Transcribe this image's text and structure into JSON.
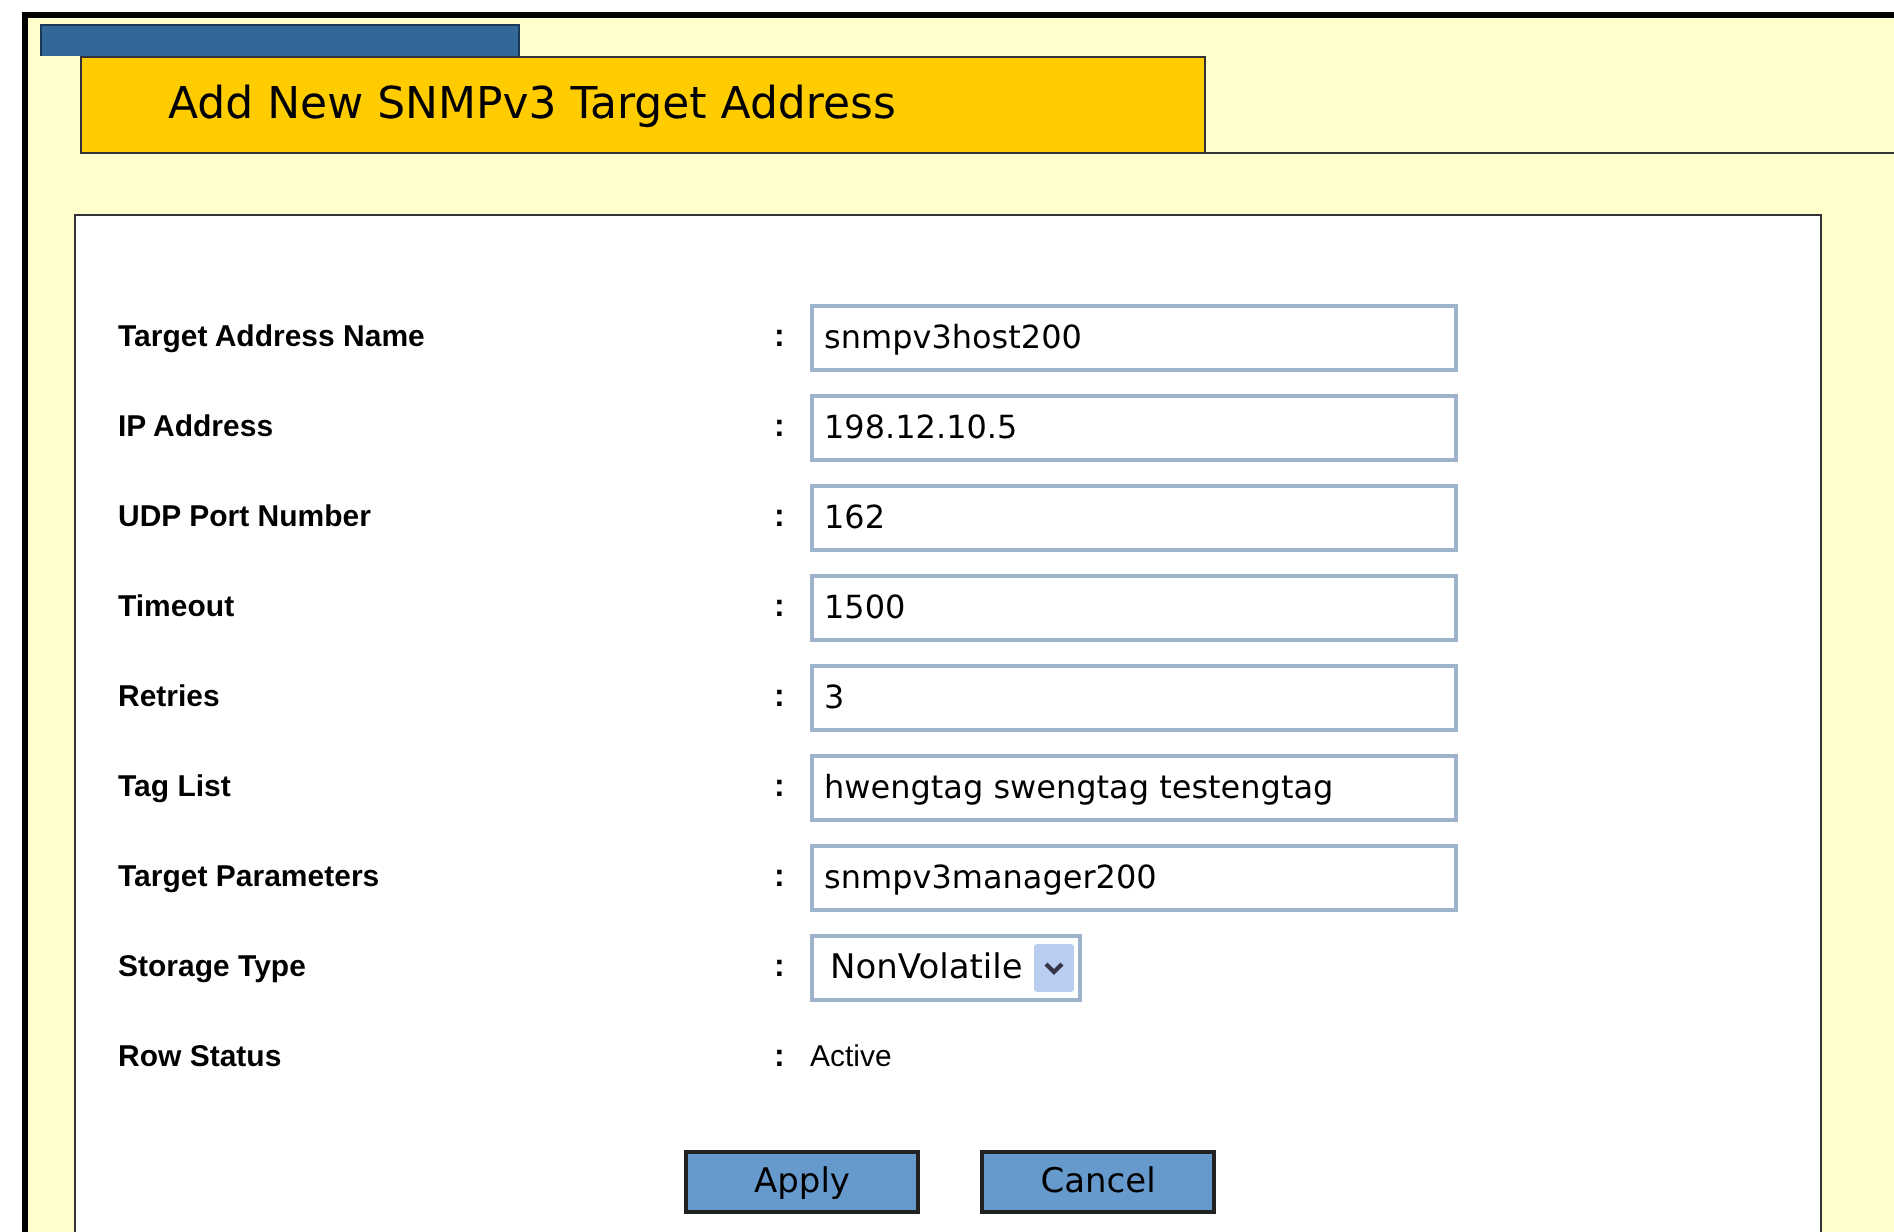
{
  "title": "Add New SNMPv3 Target Address",
  "fields": [
    {
      "label": "Target Address Name",
      "kind": "text",
      "value": "snmpv3host200"
    },
    {
      "label": "IP Address",
      "kind": "text",
      "value": "198.12.10.5"
    },
    {
      "label": "UDP Port Number",
      "kind": "text",
      "value": "162"
    },
    {
      "label": "Timeout",
      "kind": "text",
      "value": "1500"
    },
    {
      "label": "Retries",
      "kind": "text",
      "value": "3"
    },
    {
      "label": "Tag List",
      "kind": "text",
      "value": "hwengtag swengtag testengtag"
    },
    {
      "label": "Target Parameters",
      "kind": "text",
      "value": "snmpv3manager200"
    },
    {
      "label": "Storage Type",
      "kind": "select",
      "value": "NonVolatile"
    },
    {
      "label": "Row Status",
      "kind": "static",
      "value": "Active"
    }
  ],
  "separator": ":",
  "buttons": [
    "Apply",
    "Cancel"
  ]
}
